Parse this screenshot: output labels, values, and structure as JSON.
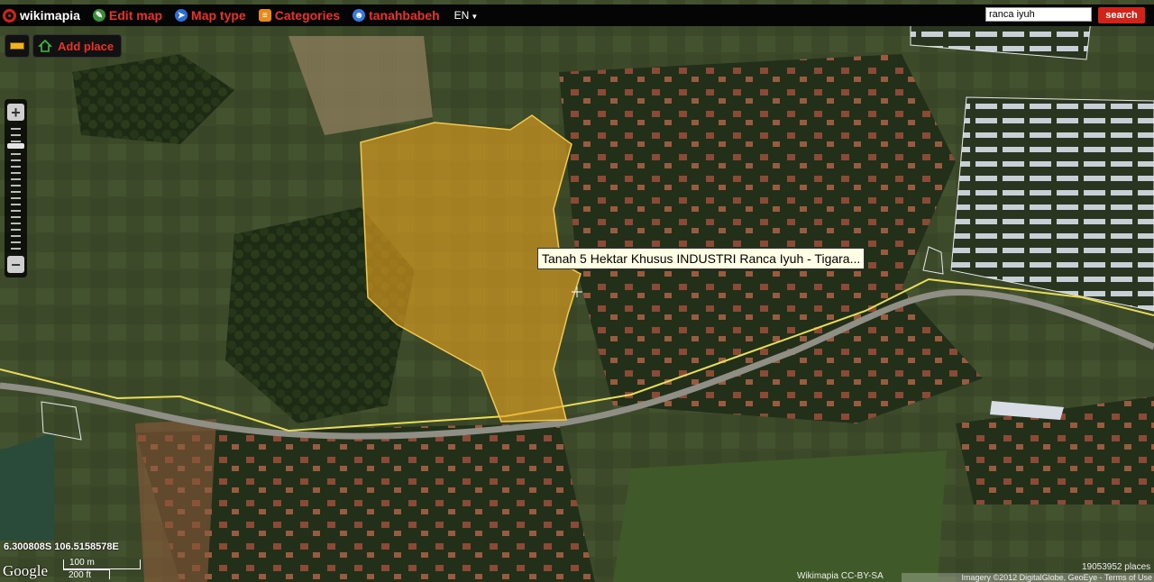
{
  "topbar": {
    "logo_text": "wikimapia",
    "menu": [
      {
        "label": "Edit map",
        "icon": "edit-map-icon"
      },
      {
        "label": "Map type",
        "icon": "compass-icon"
      },
      {
        "label": "Categories",
        "icon": "categories-icon"
      },
      {
        "label": "tanahbabeh",
        "icon": "user-icon"
      }
    ],
    "language": "EN",
    "search_value": "ranca iyuh",
    "search_button": "search"
  },
  "controls": {
    "add_place_label": "Add place",
    "ruler_icon": "ruler-icon",
    "zoom_in": "+",
    "zoom_out": "−"
  },
  "map": {
    "tooltip": "Tanah 5 Hektar Khusus INDUSTRI Ranca Iyuh - Tigara...",
    "coordinates": "6.300808S 106.5158578E",
    "google": "Google",
    "scale_metric": "100 m",
    "scale_imperial": "200 ft",
    "license": "Wikimapia CC-BY-SA",
    "places_count": "19053952 places",
    "imagery": "Imagery ©2012 DigitalGlobe, GeoEye - Terms of Use"
  },
  "colors": {
    "accent": "#e8332b",
    "polygon_fill": "#e6a321",
    "road_line": "#e8dc5a"
  }
}
